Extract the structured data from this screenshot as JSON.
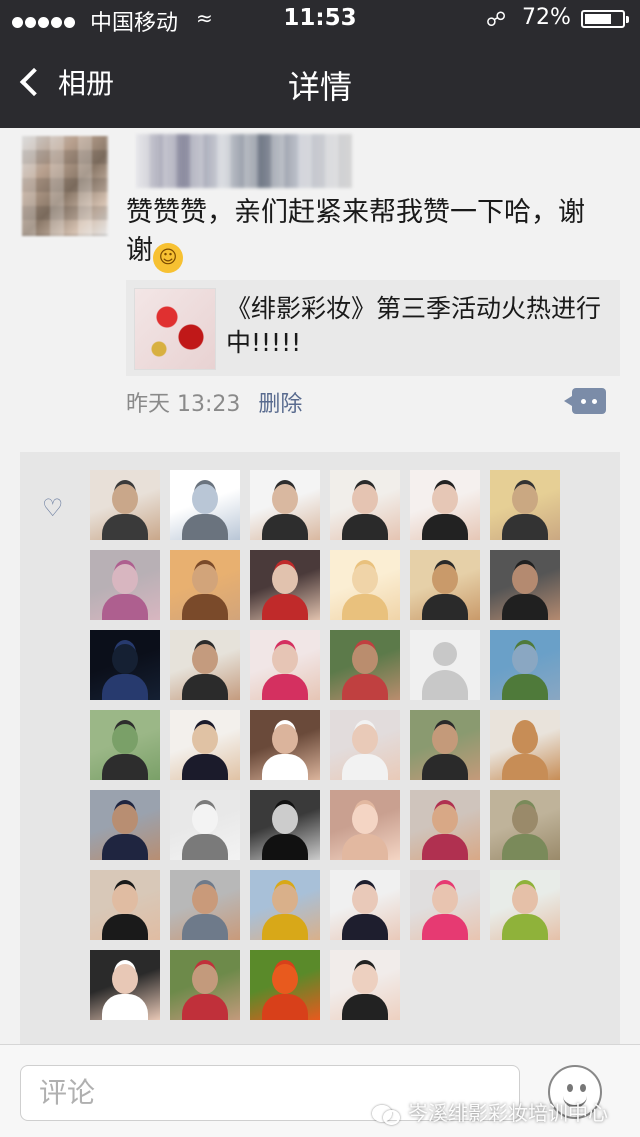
{
  "status_bar": {
    "carrier": "中国移动",
    "time": "11:53",
    "battery": "72%"
  },
  "nav": {
    "back_label": "相册",
    "title": "详情"
  },
  "post": {
    "text": "赞赞赞，亲们赶紧来帮我赞一下哈，谢谢",
    "shared_title": "《绯影彩妆》第三季活动火热进行中!!!!!",
    "timestamp": "昨天 13:23",
    "delete_label": "删除"
  },
  "likes": {
    "icon": "heart-icon",
    "avatars": [
      [
        "#c9a78a",
        "#3a3a3a",
        "#e8e0d8"
      ],
      [
        "#b9c6d6",
        "#6a737e",
        "#ffffff"
      ],
      [
        "#d9b8a0",
        "#2d2d2d",
        "#f4f4f4"
      ],
      [
        "#e5c4b2",
        "#2a2a2a",
        "#f1eeea"
      ],
      [
        "#e6c7b6",
        "#222222",
        "#f5f0ee"
      ],
      [
        "#caa882",
        "#333333",
        "#e6cf95"
      ],
      [
        "#d8b6c0",
        "#ae5f8f",
        "#b8b0b5"
      ],
      [
        "#d2a47a",
        "#7a4a2a",
        "#e8b070"
      ],
      [
        "#e1c2ae",
        "#c02a2a",
        "#4a3a3a"
      ],
      [
        "#f0d4a8",
        "#e9c17d",
        "#fbeed3"
      ],
      [
        "#c99a6a",
        "#2a2a2a",
        "#e6d0a8"
      ],
      [
        "#b48a70",
        "#202020",
        "#555555"
      ],
      [
        "#152033",
        "#273a6e",
        "#0b0f1a"
      ],
      [
        "#c49b7e",
        "#2b2b2b",
        "#e6e2da"
      ],
      [
        "#e6c5b5",
        "#d43060",
        "#f1e6e6"
      ],
      [
        "#ba8d6e",
        "#c04040",
        "#5c7a4a"
      ],
      [
        "#cccccc",
        "#cccccc",
        "#f0f0f0"
      ],
      [
        "#8aa7c2",
        "#4f7a3a",
        "#6aa0c8"
      ],
      [
        "#7aa068",
        "#2d2d2d",
        "#9bb787"
      ],
      [
        "#e0c2a4",
        "#1b1b2b",
        "#f3f0ec"
      ],
      [
        "#dbb49c",
        "#ffffff",
        "#6a4a3a"
      ],
      [
        "#e9cab8",
        "#f2f2f2",
        "#e2dcdc"
      ],
      [
        "#c49a7a",
        "#2a2a2a",
        "#8a9a70"
      ],
      [
        "#c78d56",
        "#c78d56",
        "#e9e3db"
      ],
      [
        "#b88e72",
        "#1f2540",
        "#9aa2ae"
      ],
      [
        "#f3f3f3",
        "#7a7a7a",
        "#e8e8e8"
      ],
      [
        "#cccccc",
        "#111111",
        "#3a3a3a"
      ],
      [
        "#f4d5c4",
        "#e2b8a0",
        "#c9a090"
      ],
      [
        "#d8a886",
        "#b03050",
        "#cfc4bc"
      ],
      [
        "#9a8a6a",
        "#7a8a5a",
        "#bfb39a"
      ],
      [
        "#e0bca2",
        "#1a1a1a",
        "#d8c8b8"
      ],
      [
        "#c99a7a",
        "#6e7a8a",
        "#b8b8b8"
      ],
      [
        "#d9b08a",
        "#d8a818",
        "#a8c0d8"
      ],
      [
        "#e9c9b9",
        "#1e1e2e",
        "#f0f0f0"
      ],
      [
        "#e8c4b0",
        "#e63a72",
        "#e0dede"
      ],
      [
        "#e5c0a8",
        "#8fb23a",
        "#e8ece8"
      ],
      [
        "#e8c8b6",
        "#ffffff",
        "#2a2a2a"
      ],
      [
        "#c39a7c",
        "#c0303a",
        "#6d8a4a"
      ],
      [
        "#e85a1e",
        "#d8401a",
        "#5a8a2a"
      ],
      [
        "#edd0c0",
        "#222222",
        "#f1ecea"
      ]
    ]
  },
  "bottom_bar": {
    "comment_placeholder": "评论",
    "watermark": "岑溪绯影彩妆培训中心"
  }
}
